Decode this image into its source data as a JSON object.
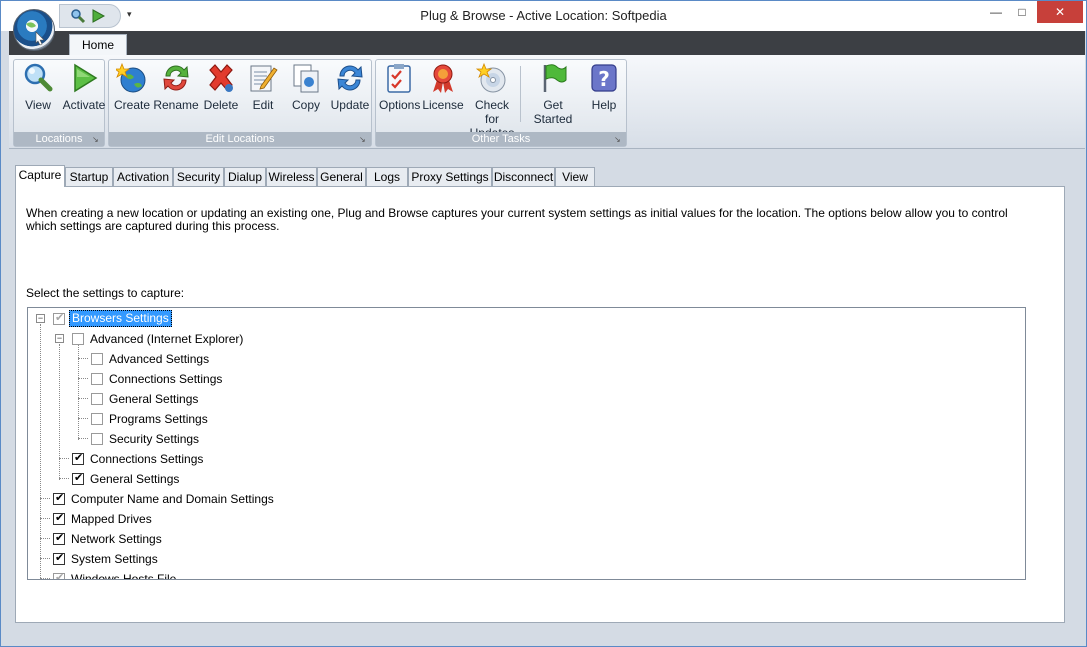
{
  "window": {
    "title": "Plug & Browse - Active Location: Softpedia",
    "min": "—",
    "max": "□",
    "close": "✕"
  },
  "qat": {
    "dropdown": "▾"
  },
  "ribbon": {
    "tab": "Home",
    "groups": [
      {
        "label": "Locations",
        "buttons": [
          {
            "label": "View",
            "icon": "search-icon"
          },
          {
            "label": "Activate",
            "icon": "play-arrow-icon"
          }
        ]
      },
      {
        "label": "Edit Locations",
        "buttons": [
          {
            "label": "Create",
            "icon": "globe-star-icon"
          },
          {
            "label": "Rename",
            "icon": "rename-arrows-icon"
          },
          {
            "label": "Delete",
            "icon": "red-x-icon"
          },
          {
            "label": "Edit",
            "icon": "notepad-pencil-icon"
          },
          {
            "label": "Copy",
            "icon": "copy-pages-icon"
          },
          {
            "label": "Update",
            "icon": "refresh-arrows-icon"
          }
        ]
      },
      {
        "label": "Other Tasks",
        "buttons": [
          {
            "label": "Options",
            "icon": "checklist-icon"
          },
          {
            "label": "License",
            "icon": "award-ribbon-icon"
          },
          {
            "label": "Check for Updates",
            "icon": "cd-star-icon"
          },
          {
            "label": "Get Started",
            "icon": "green-flag-icon"
          },
          {
            "label": "Help",
            "icon": "help-question-icon"
          }
        ]
      }
    ]
  },
  "tabs": [
    "Capture",
    "Startup",
    "Activation",
    "Security",
    "Dialup",
    "Wireless",
    "General",
    "Logs",
    "Proxy Settings",
    "Disconnect",
    "View"
  ],
  "active_tab": "Capture",
  "capture": {
    "intro": "When creating a new location or updating an existing one, Plug and Browse captures your current system settings as initial values for the location. The options below allow you to control which settings are captured during this process.",
    "select_label": "Select the settings to capture:",
    "tree": [
      {
        "label": "Browsers Settings",
        "checked": "partial",
        "selected": true,
        "expanded": true
      },
      {
        "label": "Advanced (Internet Explorer)",
        "checked": false,
        "expanded": true
      },
      {
        "label": "Advanced Settings",
        "checked": false
      },
      {
        "label": "Connections Settings",
        "checked": false
      },
      {
        "label": "General Settings",
        "checked": false
      },
      {
        "label": "Programs Settings",
        "checked": false
      },
      {
        "label": "Security Settings",
        "checked": false
      },
      {
        "label": "Connections Settings",
        "checked": true
      },
      {
        "label": "General Settings",
        "checked": true
      },
      {
        "label": "Computer Name and Domain Settings",
        "checked": true
      },
      {
        "label": "Mapped Drives",
        "checked": true
      },
      {
        "label": "Network Settings",
        "checked": true
      },
      {
        "label": "System Settings",
        "checked": true
      },
      {
        "label": "Windows Hosts File",
        "checked": "partial"
      }
    ]
  },
  "marks": {
    "check": "✔",
    "expander_minus": "−"
  }
}
